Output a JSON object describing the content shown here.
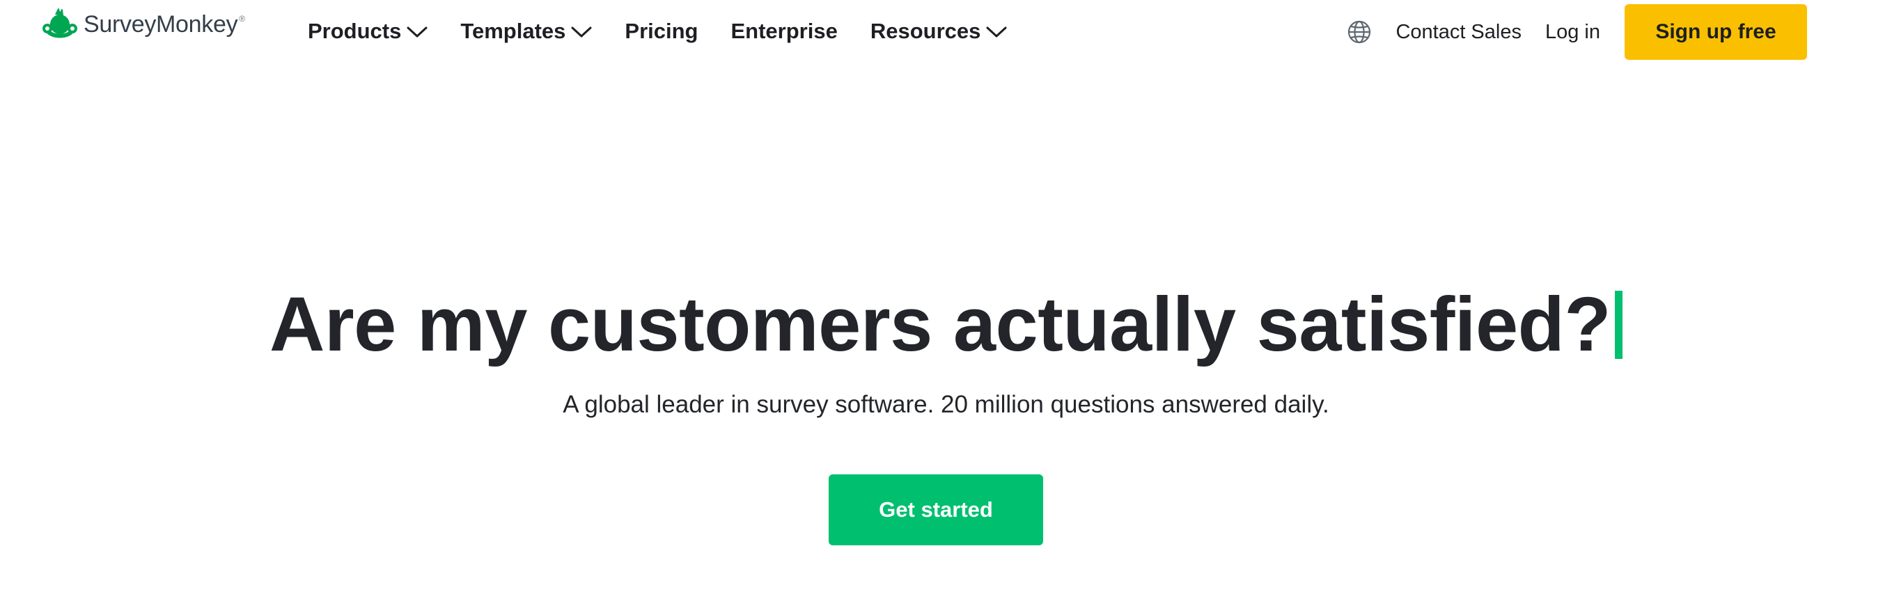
{
  "brand": {
    "name": "SurveyMonkey",
    "registered_mark": "®",
    "color": "#00bf6f"
  },
  "nav": {
    "items": [
      {
        "label": "Products",
        "has_dropdown": true,
        "icon": "chevron-down-icon"
      },
      {
        "label": "Templates",
        "has_dropdown": true,
        "icon": "chevron-down-icon"
      },
      {
        "label": "Pricing",
        "has_dropdown": false
      },
      {
        "label": "Enterprise",
        "has_dropdown": false
      },
      {
        "label": "Resources",
        "has_dropdown": true,
        "icon": "chevron-down-icon"
      }
    ]
  },
  "header_right": {
    "language_icon": "globe-icon",
    "contact_label": "Contact Sales",
    "login_label": "Log in",
    "signup_label": "Sign up free",
    "signup_color": "#fac000"
  },
  "hero": {
    "title": "Are my customers actually satisfied?",
    "subtitle": "A global leader in survey software. 20 million questions answered daily.",
    "cta_label": "Get started",
    "cta_color": "#00bf6f",
    "cursor_color": "#00bf6f"
  }
}
